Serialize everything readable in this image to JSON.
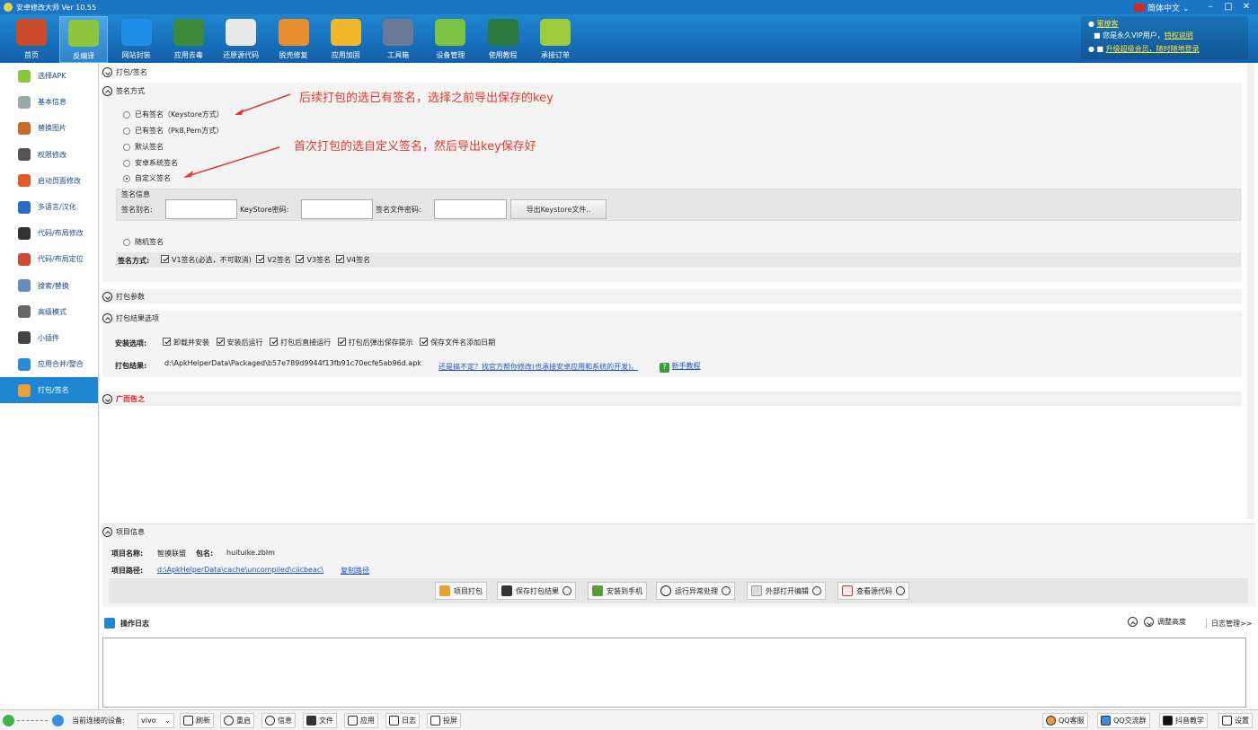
{
  "window": {
    "title": "安卓修改大师 Ver 10.55"
  },
  "toolbar": [
    {
      "label": "首页",
      "icon": "house-icon",
      "color": "#c94b2a"
    },
    {
      "label": "反编译",
      "icon": "android-icon",
      "color": "#8cc63f"
    },
    {
      "label": "网站封装",
      "icon": "ie-icon",
      "color": "#1e8ee6"
    },
    {
      "label": "应用去毒",
      "icon": "shield-icon",
      "color": "#3c8a3a"
    },
    {
      "label": "还原源代码",
      "icon": "document-icon",
      "color": "#e8e8e8"
    },
    {
      "label": "脱壳修复",
      "icon": "puzzle-icon",
      "color": "#e78f2e"
    },
    {
      "label": "应用加固",
      "icon": "lock-icon",
      "color": "#f0b72a"
    },
    {
      "label": "工具箱",
      "icon": "toolbox-icon",
      "color": "#6a7a96"
    },
    {
      "label": "设备管理",
      "icon": "monitor-icon",
      "color": "#7dc242"
    },
    {
      "label": "使用教程",
      "icon": "blackboard-icon",
      "color": "#2d7a3e"
    },
    {
      "label": "承接订单",
      "icon": "bag-icon",
      "color": "#9ccc3a"
    }
  ],
  "topright": {
    "lang": "简体中文",
    "account": "蜜撩客",
    "vip_text": "您是永久VIP用户，",
    "vip_link": "特权说明",
    "upgrade": "升级超级会员，随时随地登录"
  },
  "sidebar": [
    {
      "label": "选择APK",
      "icon": "android-icon"
    },
    {
      "label": "基本信息",
      "icon": "gear-icon"
    },
    {
      "label": "替换图片",
      "icon": "image-icon"
    },
    {
      "label": "权限修改",
      "icon": "permission-icon"
    },
    {
      "label": "启动页面修改",
      "icon": "tiles-icon"
    },
    {
      "label": "多语言/汉化",
      "icon": "globe-icon"
    },
    {
      "label": "代码/布局修改",
      "icon": "code-icon"
    },
    {
      "label": "代码/布局定位",
      "icon": "locate-icon"
    },
    {
      "label": "搜索/替换",
      "icon": "search-icon"
    },
    {
      "label": "高级模式",
      "icon": "tools-icon"
    },
    {
      "label": "小插件",
      "icon": "plugin-icon"
    },
    {
      "label": "应用合并/整合",
      "icon": "merge-icon"
    },
    {
      "label": "打包/签名",
      "icon": "package-icon"
    }
  ],
  "main": {
    "header": "打包/签名",
    "sign_section": "签名方式",
    "radios": [
      "已有签名（Keystore方式）",
      "已有签名（Pk8,Pem方式）",
      "默认签名",
      "安卓系统签名",
      "自定义签名",
      "随机签名"
    ],
    "sign_info": "签名信息",
    "alias_label": "签名别名:",
    "keystore_pwd_label": "KeyStore密码:",
    "file_pwd_label": "签名文件密码:",
    "export_btn": "导出Keystore文件..",
    "scheme_label": "签名方式:",
    "schemes": [
      "V1签名(必选，不可取消)",
      "V2签名",
      "V3签名",
      "V4签名"
    ],
    "annotation1": "后续打包的选已有签名，选择之前导出保存的key",
    "annotation2": "首次打包的选自定义签名，然后导出key保存好",
    "params_section": "打包参数",
    "result_section": "打包结果选项",
    "install_label": "安装选项:",
    "install_opts": [
      "卸载并安装",
      "安装后运行",
      "打包后直接运行",
      "打包后弹出保存提示",
      "保存文件名添加日期"
    ],
    "result_label": "打包结果:",
    "result_path": "d:\\ApkHelperData\\Packaged\\b57e789d9944f13fb91c70ecfe5ab96d.apk",
    "result_link": "还是搞不定？找官方帮你修改(也承接安卓应用和系统的开发)。",
    "tutorial": "新手教程",
    "ad_section": "广而告之"
  },
  "project": {
    "section": "项目信息",
    "name_label": "项目名称:",
    "name": "智摸联盟",
    "pkg_label": "包名:",
    "pkg": "huituike.zblm",
    "path_label": "项目路径:",
    "path": "d:\\ApkHelperData\\cache\\uncompiled\\ciicbeac\\",
    "copy": "复制路径"
  },
  "actions": [
    "项目打包",
    "保存打包结果",
    "安装到手机",
    "运行异常处理",
    "外部打开编辑",
    "查看源代码"
  ],
  "log": {
    "title": "操作日志",
    "adjust": "调整高度",
    "manage": "日志管理>>"
  },
  "status": {
    "device_label": "当前连接的设备:",
    "device": "vivo",
    "buttons": [
      "刷新",
      "重启",
      "信息",
      "文件",
      "应用",
      "日志",
      "投屏"
    ],
    "right": [
      "QQ客服",
      "QQ交流群",
      "抖音教学",
      "设置"
    ]
  }
}
